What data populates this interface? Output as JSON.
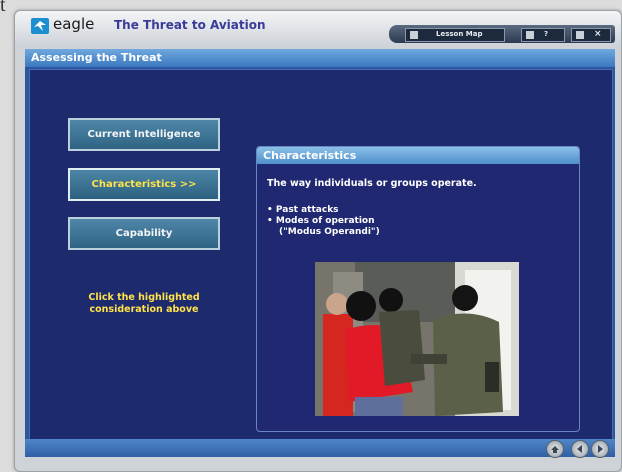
{
  "corner_glyph": "t",
  "app": {
    "brand": "eagle",
    "course_title": "The Threat to Aviation"
  },
  "toolbar": {
    "lesson_map_label": "Lesson Map",
    "help_label": "?",
    "close_label": "×"
  },
  "section": {
    "title": "Assessing the Threat"
  },
  "nav": {
    "items": [
      {
        "label": "Current Intelligence",
        "active": false
      },
      {
        "label": "Characteristics >>",
        "active": true
      },
      {
        "label": "Capability",
        "active": false
      }
    ],
    "hint": "Click the highlighted consideration above"
  },
  "panel": {
    "title": "Characteristics",
    "description": "The way individuals or groups operate.",
    "bullets": [
      "• Past attacks",
      "• Modes of operation",
      "(\"Modus Operandi\")"
    ]
  },
  "colors": {
    "content_bg": "#1e2a6e",
    "active_text": "#ffe24a",
    "header_blue": "#4f8fcc"
  },
  "icons": [
    "eagle-logo-icon",
    "home-icon",
    "back-icon",
    "forward-icon",
    "menu-icon",
    "help-icon",
    "close-icon"
  ]
}
